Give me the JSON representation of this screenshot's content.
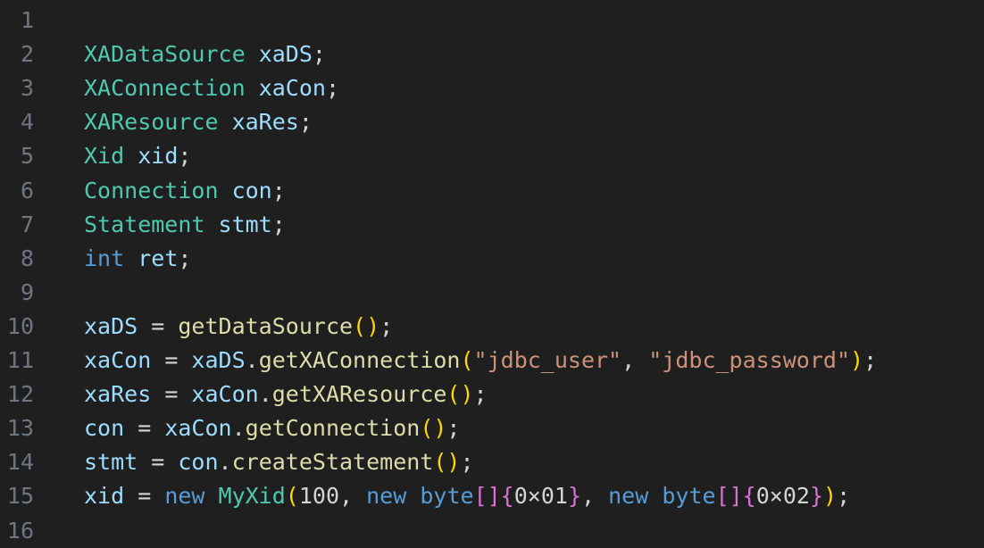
{
  "colors": {
    "background": "#1f1f1f",
    "line_number": "#6e7681",
    "type": "#4ec9b0",
    "variable": "#9cdcfe",
    "keyword": "#569cd6",
    "function": "#dcdcaa",
    "string": "#ce9178",
    "bracket_level1": "#ffd700",
    "bracket_level2": "#da70d6"
  },
  "lines": [
    {
      "n": "1",
      "tokens": []
    },
    {
      "n": "2",
      "tokens": [
        {
          "t": "XADataSource",
          "c": "type"
        },
        {
          "t": " ",
          "c": "plain"
        },
        {
          "t": "xaDS",
          "c": "var"
        },
        {
          "t": ";",
          "c": "plain"
        }
      ]
    },
    {
      "n": "3",
      "tokens": [
        {
          "t": "XAConnection",
          "c": "type"
        },
        {
          "t": " ",
          "c": "plain"
        },
        {
          "t": "xaCon",
          "c": "var"
        },
        {
          "t": ";",
          "c": "plain"
        }
      ]
    },
    {
      "n": "4",
      "tokens": [
        {
          "t": "XAResource",
          "c": "type"
        },
        {
          "t": " ",
          "c": "plain"
        },
        {
          "t": "xaRes",
          "c": "var"
        },
        {
          "t": ";",
          "c": "plain"
        }
      ]
    },
    {
      "n": "5",
      "tokens": [
        {
          "t": "Xid",
          "c": "type"
        },
        {
          "t": " ",
          "c": "plain"
        },
        {
          "t": "xid",
          "c": "var"
        },
        {
          "t": ";",
          "c": "plain"
        }
      ]
    },
    {
      "n": "6",
      "tokens": [
        {
          "t": "Connection",
          "c": "type"
        },
        {
          "t": " ",
          "c": "plain"
        },
        {
          "t": "con",
          "c": "var"
        },
        {
          "t": ";",
          "c": "plain"
        }
      ]
    },
    {
      "n": "7",
      "tokens": [
        {
          "t": "Statement",
          "c": "type"
        },
        {
          "t": " ",
          "c": "plain"
        },
        {
          "t": "stmt",
          "c": "var"
        },
        {
          "t": ";",
          "c": "plain"
        }
      ]
    },
    {
      "n": "8",
      "tokens": [
        {
          "t": "int",
          "c": "kw"
        },
        {
          "t": " ",
          "c": "plain"
        },
        {
          "t": "ret",
          "c": "var"
        },
        {
          "t": ";",
          "c": "plain"
        }
      ]
    },
    {
      "n": "9",
      "tokens": []
    },
    {
      "n": "10",
      "tokens": [
        {
          "t": "xaDS",
          "c": "var"
        },
        {
          "t": " = ",
          "c": "plain"
        },
        {
          "t": "getDataSource",
          "c": "fn"
        },
        {
          "t": "()",
          "c": "p1"
        },
        {
          "t": ";",
          "c": "plain"
        }
      ]
    },
    {
      "n": "11",
      "tokens": [
        {
          "t": "xaCon",
          "c": "var"
        },
        {
          "t": " = ",
          "c": "plain"
        },
        {
          "t": "xaDS",
          "c": "var"
        },
        {
          "t": ".",
          "c": "plain"
        },
        {
          "t": "getXAConnection",
          "c": "fn"
        },
        {
          "t": "(",
          "c": "p1"
        },
        {
          "t": "\"jdbc_user\"",
          "c": "str"
        },
        {
          "t": ", ",
          "c": "plain"
        },
        {
          "t": "\"jdbc_password\"",
          "c": "str"
        },
        {
          "t": ")",
          "c": "p1"
        },
        {
          "t": ";",
          "c": "plain"
        }
      ]
    },
    {
      "n": "12",
      "tokens": [
        {
          "t": "xaRes",
          "c": "var"
        },
        {
          "t": " = ",
          "c": "plain"
        },
        {
          "t": "xaCon",
          "c": "var"
        },
        {
          "t": ".",
          "c": "plain"
        },
        {
          "t": "getXAResource",
          "c": "fn"
        },
        {
          "t": "()",
          "c": "p1"
        },
        {
          "t": ";",
          "c": "plain"
        }
      ]
    },
    {
      "n": "13",
      "tokens": [
        {
          "t": "con",
          "c": "var"
        },
        {
          "t": " = ",
          "c": "plain"
        },
        {
          "t": "xaCon",
          "c": "var"
        },
        {
          "t": ".",
          "c": "plain"
        },
        {
          "t": "getConnection",
          "c": "fn"
        },
        {
          "t": "()",
          "c": "p1"
        },
        {
          "t": ";",
          "c": "plain"
        }
      ]
    },
    {
      "n": "14",
      "tokens": [
        {
          "t": "stmt",
          "c": "var"
        },
        {
          "t": " = ",
          "c": "plain"
        },
        {
          "t": "con",
          "c": "var"
        },
        {
          "t": ".",
          "c": "plain"
        },
        {
          "t": "createStatement",
          "c": "fn"
        },
        {
          "t": "()",
          "c": "p1"
        },
        {
          "t": ";",
          "c": "plain"
        }
      ]
    },
    {
      "n": "15",
      "tokens": [
        {
          "t": "xid",
          "c": "var"
        },
        {
          "t": " = ",
          "c": "plain"
        },
        {
          "t": "new",
          "c": "kw"
        },
        {
          "t": " ",
          "c": "plain"
        },
        {
          "t": "MyXid",
          "c": "type"
        },
        {
          "t": "(",
          "c": "p1"
        },
        {
          "t": "100",
          "c": "plain"
        },
        {
          "t": ", ",
          "c": "plain"
        },
        {
          "t": "new",
          "c": "kw"
        },
        {
          "t": " ",
          "c": "plain"
        },
        {
          "t": "byte",
          "c": "kw"
        },
        {
          "t": "[]",
          "c": "p2"
        },
        {
          "t": "{",
          "c": "p2"
        },
        {
          "t": "0×01",
          "c": "plain"
        },
        {
          "t": "}",
          "c": "p2"
        },
        {
          "t": ", ",
          "c": "plain"
        },
        {
          "t": "new",
          "c": "kw"
        },
        {
          "t": " ",
          "c": "plain"
        },
        {
          "t": "byte",
          "c": "kw"
        },
        {
          "t": "[]",
          "c": "p2"
        },
        {
          "t": "{",
          "c": "p2"
        },
        {
          "t": "0×02",
          "c": "plain"
        },
        {
          "t": "}",
          "c": "p2"
        },
        {
          "t": ")",
          "c": "p1"
        },
        {
          "t": ";",
          "c": "plain"
        }
      ]
    },
    {
      "n": "16",
      "tokens": []
    }
  ]
}
